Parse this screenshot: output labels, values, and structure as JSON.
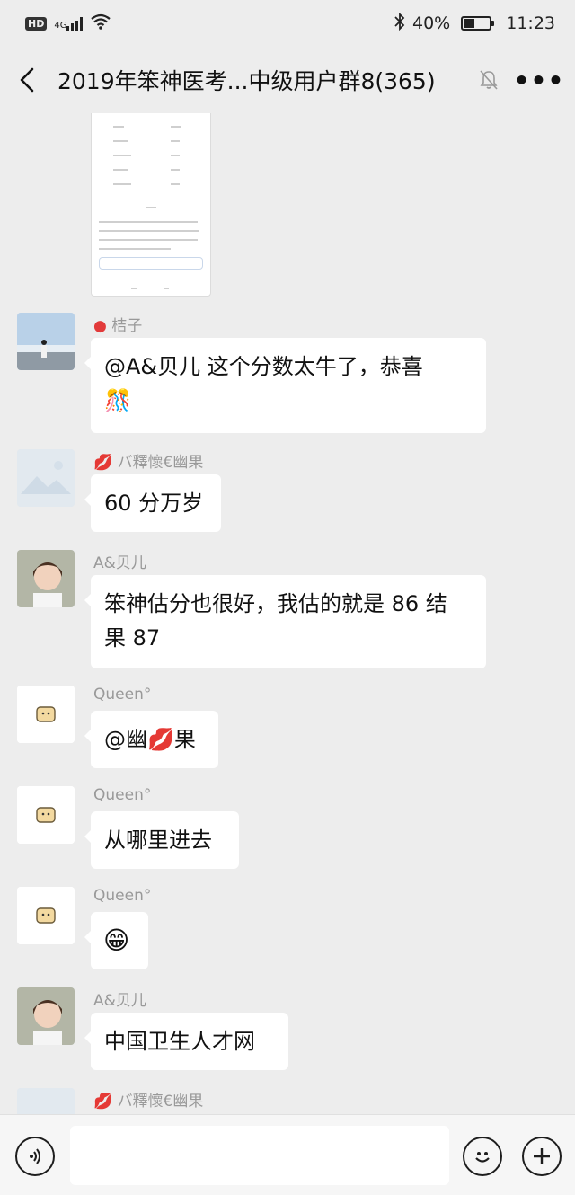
{
  "status_bar": {
    "hd": "HD",
    "network": "4G",
    "battery_percent": "40%",
    "time": "11:23",
    "battery_level": 0.4
  },
  "nav": {
    "title": "2019年笨神医考...中级用户群8(365)",
    "more": "•••"
  },
  "messages": [
    {
      "sender": "桔子",
      "text": "@A&贝儿  这个分数太牛了，恭喜",
      "extra_emoji": "🎊"
    },
    {
      "sender": "バ釋懷€幽果",
      "text": "60 分万岁"
    },
    {
      "sender": "A&贝儿",
      "line1": "笨神估分也很好，我估的就是 86 结",
      "line2": "果 87"
    },
    {
      "sender": "Queen°",
      "text_a": "@幽",
      "emoji": "💋",
      "text_b": "果"
    },
    {
      "sender": "Queen°",
      "text": "从哪里进去"
    },
    {
      "sender": "Queen°",
      "emoji": "😁"
    },
    {
      "sender": "A&贝儿",
      "text": "中国卫生人才网"
    },
    {
      "sender": "バ釋懷€幽果"
    }
  ],
  "icons": {
    "back": "chevron-left-icon",
    "mute": "bell-off-icon",
    "voice": "voice-icon",
    "emoji": "smiley-icon",
    "plus": "plus-icon",
    "balloon": "balloon-icon",
    "lips": "lips-icon"
  },
  "colors": {
    "background": "#ededed",
    "bubble": "#ffffff",
    "sender": "#999999"
  }
}
